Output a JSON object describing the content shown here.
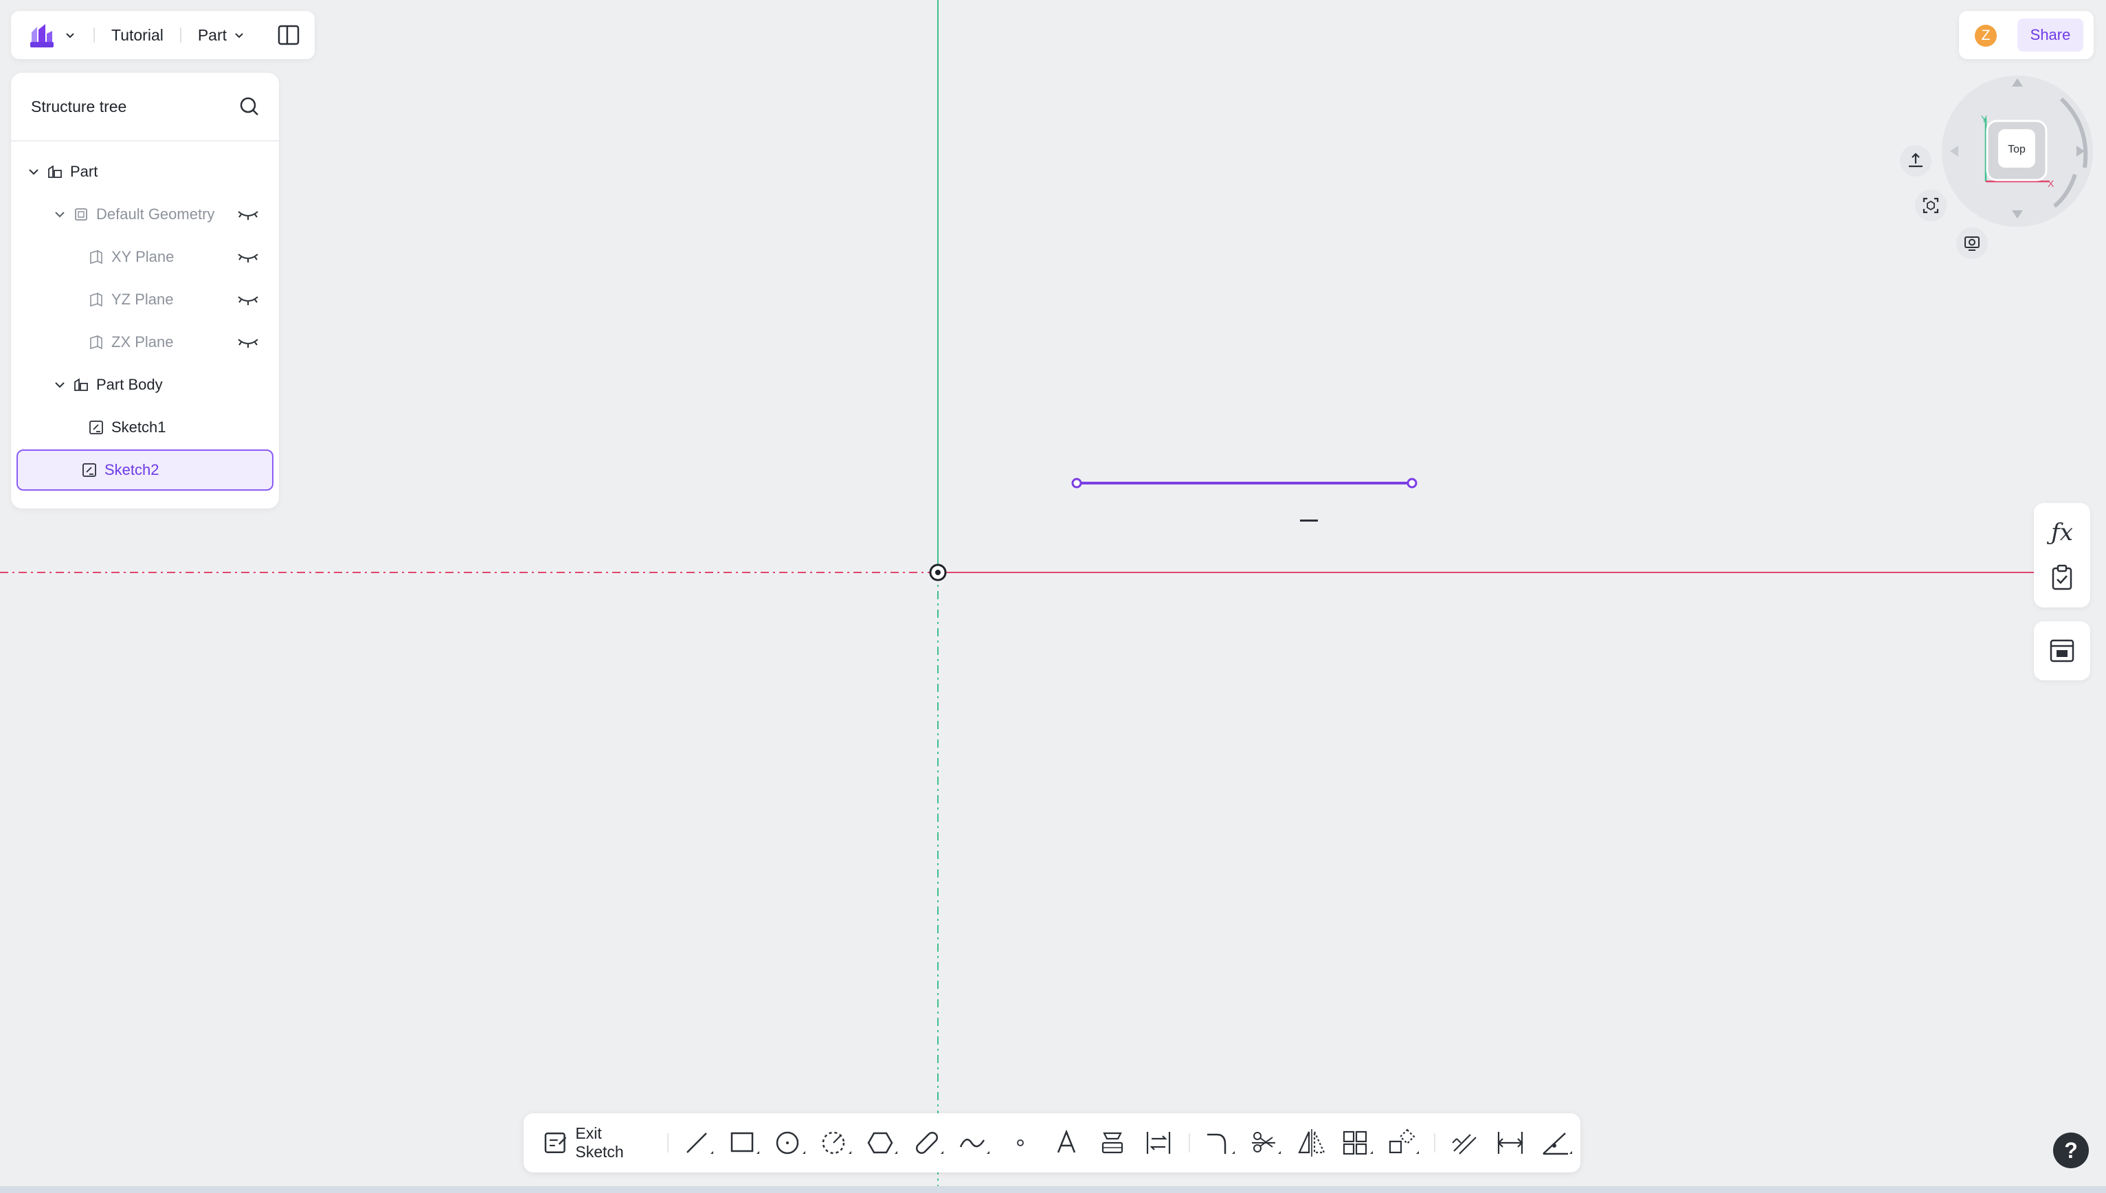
{
  "app": {
    "project_name": "Tutorial",
    "mode": "Part",
    "share_label": "Share",
    "user_initial": "Z",
    "help_label": "?",
    "accent_color": "#8b5cf6"
  },
  "tree": {
    "title": "Structure tree",
    "items": [
      {
        "label": "Part",
        "icon": "part-icon"
      },
      {
        "label": "Default Geometry",
        "icon": "geometry-icon"
      },
      {
        "label": "XY Plane",
        "icon": "plane-icon"
      },
      {
        "label": "YZ Plane",
        "icon": "plane-icon"
      },
      {
        "label": "ZX Plane",
        "icon": "plane-icon"
      },
      {
        "label": "Part Body",
        "icon": "body-icon"
      },
      {
        "label": "Sketch1",
        "icon": "sketch-icon"
      },
      {
        "label": "Sketch2",
        "icon": "sketch-icon",
        "selected": true
      }
    ]
  },
  "viewcube": {
    "face_label": "Top",
    "axis_x": "X",
    "axis_y": "Y"
  },
  "toolbar": {
    "exit_label": "Exit Sketch",
    "tools": [
      "line-icon",
      "rectangle-icon",
      "circle-icon",
      "arc-icon",
      "polygon-icon",
      "slot-icon",
      "spline-icon",
      "point-icon",
      "text-icon",
      "project-icon",
      "convert-icon",
      "fillet-icon",
      "trim-icon",
      "mirror-icon",
      "pattern-icon",
      "transform-icon",
      "offset-icon",
      "dimension-icon",
      "constraint-icon"
    ]
  },
  "side_tools": [
    "formula-icon",
    "check-icon",
    "table-icon"
  ],
  "colors": {
    "x_axis": "#e0456f",
    "y_axis": "#3fbf8f",
    "sketch_line": "#7b3fe4"
  }
}
